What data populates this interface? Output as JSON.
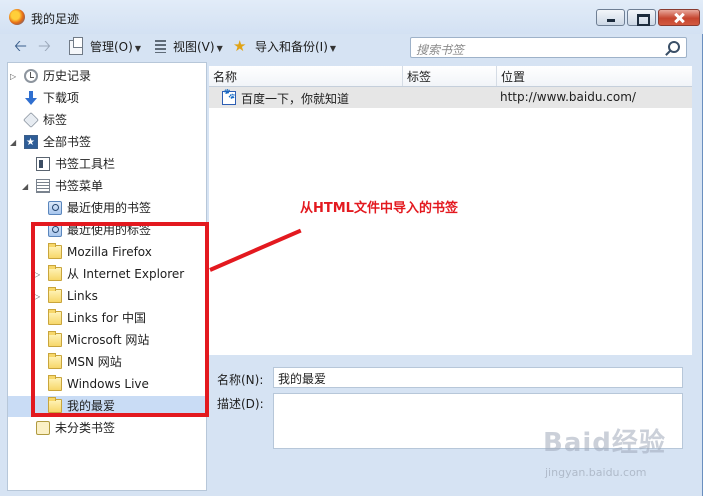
{
  "window": {
    "title": "我的足迹"
  },
  "toolbar": {
    "organize_label": "管理(O)",
    "views_label": "视图(V)",
    "import_label": "导入和备份(I)",
    "search_placeholder": "搜索书签"
  },
  "sidebar": {
    "items": [
      {
        "label": "历史记录",
        "icon": "history-icon"
      },
      {
        "label": "下载项",
        "icon": "download-icon"
      },
      {
        "label": "标签",
        "icon": "tag-icon"
      },
      {
        "label": "全部书签",
        "icon": "all-bookmarks-icon"
      },
      {
        "label": "书签工具栏",
        "icon": "bookmarks-toolbar-icon"
      },
      {
        "label": "书签菜单",
        "icon": "bookmarks-menu-icon"
      },
      {
        "label": "最近使用的书签",
        "icon": "smart-query-icon"
      },
      {
        "label": "最近使用的标签",
        "icon": "smart-query-icon"
      },
      {
        "label": "Mozilla Firefox",
        "icon": "folder-icon"
      },
      {
        "label": "从 Internet Explorer",
        "icon": "folder-icon"
      },
      {
        "label": "Links",
        "icon": "folder-icon"
      },
      {
        "label": "Links for 中国",
        "icon": "folder-icon"
      },
      {
        "label": "Microsoft 网站",
        "icon": "folder-icon"
      },
      {
        "label": "MSN 网站",
        "icon": "folder-icon"
      },
      {
        "label": "Windows Live",
        "icon": "folder-icon"
      },
      {
        "label": "我的最爱",
        "icon": "folder-icon"
      },
      {
        "label": "未分类书签",
        "icon": "unsorted-bookmarks-icon"
      }
    ]
  },
  "list": {
    "columns": [
      "名称",
      "标签",
      "位置"
    ],
    "rows": [
      {
        "name": "百度一下，你就知道",
        "tags": "",
        "location": "http://www.baidu.com/"
      }
    ]
  },
  "details": {
    "name_label": "名称(N):",
    "name_value": "我的最爱",
    "description_label": "描述(D):",
    "description_value": ""
  },
  "annotation": {
    "text": "从HTML文件中导入的书签",
    "color": "#e3191f"
  },
  "watermark": {
    "text": "Baid经验",
    "url": "jingyan.baidu.com"
  },
  "colors": {
    "accent": "#4a7eb0",
    "highlight": "#e3191f",
    "selection": "#c9dcf5"
  }
}
